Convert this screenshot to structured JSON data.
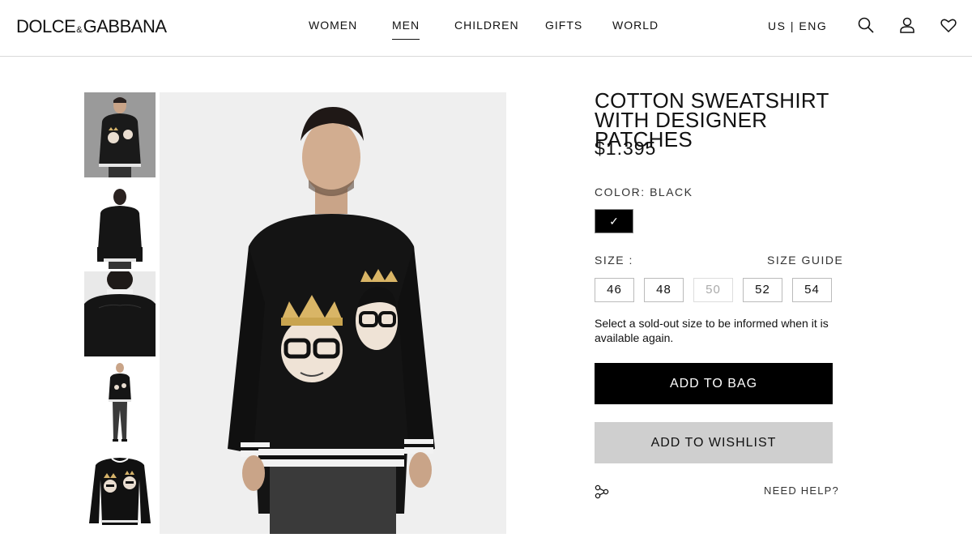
{
  "brand": {
    "logo_left": "DOLCE",
    "logo_amp": "&",
    "logo_right": "GABBANA"
  },
  "nav": {
    "items": [
      {
        "label": "WOMEN"
      },
      {
        "label": "MEN",
        "active": true
      },
      {
        "label": "CHILDREN"
      },
      {
        "label": "GIFTS"
      },
      {
        "label": "WORLD"
      }
    ]
  },
  "header": {
    "locale": "US | ENG",
    "icons": [
      "search-icon",
      "account-icon",
      "wishlist-heart-icon"
    ]
  },
  "gallery": {
    "thumbnails": [
      "front view",
      "back view",
      "back detail",
      "full look",
      "product flat"
    ]
  },
  "product": {
    "title": "COTTON SWEATSHIRT WITH DESIGNER PATCHES",
    "price": "$1.395",
    "color_label": "COLOR:",
    "color_value": "BLACK",
    "swatch_check": "✓",
    "size_label": "SIZE :",
    "size_guide": "SIZE GUIDE",
    "sizes": [
      {
        "label": "46",
        "sold_out": false
      },
      {
        "label": "48",
        "sold_out": false
      },
      {
        "label": "50",
        "sold_out": true
      },
      {
        "label": "52",
        "sold_out": false
      },
      {
        "label": "54",
        "sold_out": false
      }
    ],
    "soldout_note": "Select a sold-out size to be informed when it is available again.",
    "add_to_bag": "ADD TO BAG",
    "add_to_wishlist": "ADD TO WISHLIST",
    "need_help": "NEED HELP?"
  },
  "colors": {
    "accent": "#000000",
    "wishlist_bg": "#cfcfcf",
    "sold_out_text": "#aaaaaa"
  }
}
